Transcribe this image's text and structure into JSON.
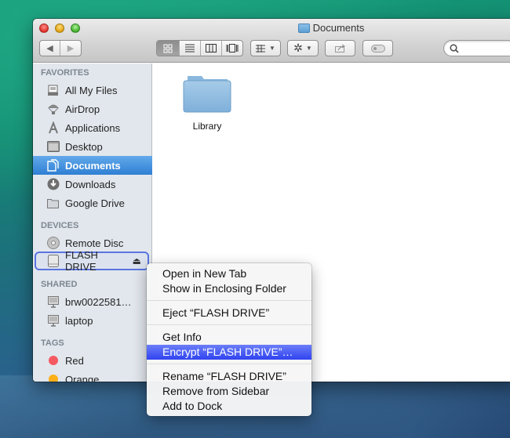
{
  "window": {
    "title": "Documents",
    "search_placeholder": ""
  },
  "toolbar": {
    "back": "◀",
    "forward": "▶",
    "view_modes": [
      {
        "name": "icon-view",
        "glyph": "▦",
        "active": true
      },
      {
        "name": "list-view",
        "glyph": "☰",
        "active": false
      },
      {
        "name": "column-view",
        "glyph": "▥",
        "active": false
      },
      {
        "name": "cover-flow-view",
        "glyph": "▯",
        "active": false
      }
    ],
    "arrange_glyph": "▦ ▾",
    "action_glyph": "✲ ▾",
    "share_glyph": "⇪",
    "tags_glyph": "⬭",
    "search_glyph": "⚲"
  },
  "sidebar": {
    "favorites_header": "FAVORITES",
    "favorites": [
      {
        "label": "All My Files",
        "icon": "all-files-icon"
      },
      {
        "label": "AirDrop",
        "icon": "airdrop-icon"
      },
      {
        "label": "Applications",
        "icon": "applications-icon"
      },
      {
        "label": "Desktop",
        "icon": "desktop-icon"
      },
      {
        "label": "Documents",
        "icon": "documents-icon",
        "selected": true
      },
      {
        "label": "Downloads",
        "icon": "downloads-icon"
      },
      {
        "label": "Google Drive",
        "icon": "folder-icon"
      }
    ],
    "devices_header": "DEVICES",
    "devices": [
      {
        "label": "Remote Disc",
        "icon": "disc-icon"
      },
      {
        "label": "FLASH DRIVE",
        "icon": "drive-icon",
        "eject": "⏏"
      }
    ],
    "shared_header": "SHARED",
    "shared": [
      {
        "label": "brw0022581…",
        "icon": "computer-icon"
      },
      {
        "label": "laptop",
        "icon": "computer-icon"
      }
    ],
    "tags_header": "TAGS",
    "tags": [
      {
        "label": "Red",
        "color": "#f55a63"
      },
      {
        "label": "Orange",
        "color": "#fcaf1a"
      }
    ]
  },
  "content": {
    "files": [
      {
        "label": "Library",
        "type": "folder"
      }
    ]
  },
  "context_menu": {
    "groups": [
      [
        "Open in New Tab",
        "Show in Enclosing Folder"
      ],
      [
        "Eject “FLASH DRIVE”"
      ],
      [
        "Get Info",
        "Encrypt “FLASH DRIVE”…"
      ],
      [
        "Rename “FLASH DRIVE”",
        "Remove from Sidebar",
        "Add to Dock"
      ]
    ],
    "highlighted": "Encrypt “FLASH DRIVE”…"
  },
  "colors": {
    "selection_blue": "#2e7fd4",
    "menu_highlight": "#3043f0",
    "outline_blue": "#5a74df"
  }
}
